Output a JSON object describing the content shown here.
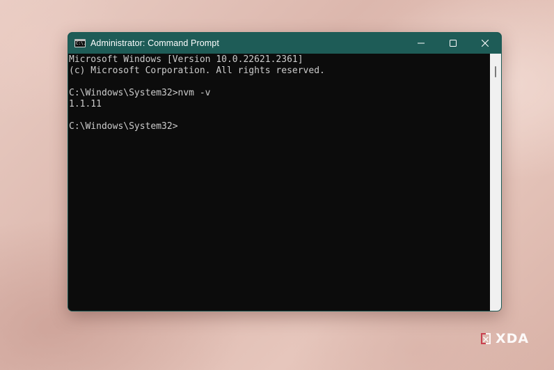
{
  "window": {
    "title": "Administrator: Command Prompt",
    "icon": "command-prompt-icon",
    "icon_text": "C:\\.",
    "controls": [
      "minimize-icon",
      "maximize-icon",
      "close-icon"
    ],
    "titlebar_color": "#1e5c57"
  },
  "terminal": {
    "background": "#0c0c0c",
    "foreground": "#cccccc",
    "lines": [
      "Microsoft Windows [Version 10.0.22621.2361]",
      "(c) Microsoft Corporation. All rights reserved.",
      "",
      "C:\\Windows\\System32>nvm -v",
      "1.1.11",
      "",
      "C:\\Windows\\System32>"
    ]
  },
  "watermark": {
    "logo": "xda-logo",
    "text": "XDA"
  }
}
